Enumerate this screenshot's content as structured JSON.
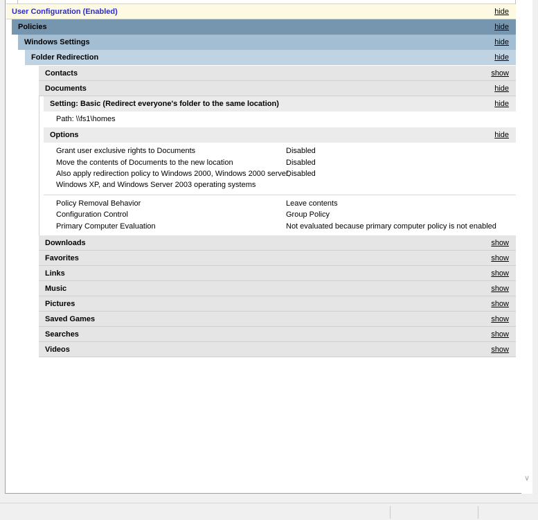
{
  "user_config": {
    "title": "User Configuration (Enabled)",
    "toggle": "hide"
  },
  "policies": {
    "title": "Policies",
    "toggle": "hide"
  },
  "windows_settings": {
    "title": "Windows Settings",
    "toggle": "hide"
  },
  "folder_redirection": {
    "title": "Folder Redirection",
    "toggle": "hide"
  },
  "contacts": {
    "title": "Contacts",
    "toggle": "show"
  },
  "documents": {
    "title": "Documents",
    "toggle": "hide",
    "setting": {
      "title": "Setting: Basic (Redirect everyone's folder to the same location)",
      "toggle": "hide"
    },
    "path": "Path: \\\\fs1\\homes",
    "options": {
      "title": "Options",
      "toggle": "hide",
      "rows1": [
        {
          "label": "Grant user exclusive rights to Documents",
          "value": "Disabled"
        },
        {
          "label": "Move the contents of Documents to the new location",
          "value": "Disabled"
        },
        {
          "label": "Also apply redirection policy to Windows 2000, Windows 2000 server,",
          "label2": "Windows XP, and Windows Server 2003 operating systems",
          "value": "Disabled"
        }
      ],
      "rows2": [
        {
          "label": "Policy Removal Behavior",
          "value": "Leave contents"
        },
        {
          "label": "Configuration Control",
          "value": "Group Policy"
        },
        {
          "label": "Primary Computer Evaluation",
          "value": "Not evaluated because primary computer policy is not enabled"
        }
      ]
    }
  },
  "folders": [
    {
      "title": "Downloads",
      "toggle": "show"
    },
    {
      "title": "Favorites",
      "toggle": "show"
    },
    {
      "title": "Links",
      "toggle": "show"
    },
    {
      "title": "Music",
      "toggle": "show"
    },
    {
      "title": "Pictures",
      "toggle": "show"
    },
    {
      "title": "Saved Games",
      "toggle": "show"
    },
    {
      "title": "Searches",
      "toggle": "show"
    },
    {
      "title": "Videos",
      "toggle": "show"
    }
  ],
  "icons": {
    "scroll_down": "chevron-down-icon"
  }
}
